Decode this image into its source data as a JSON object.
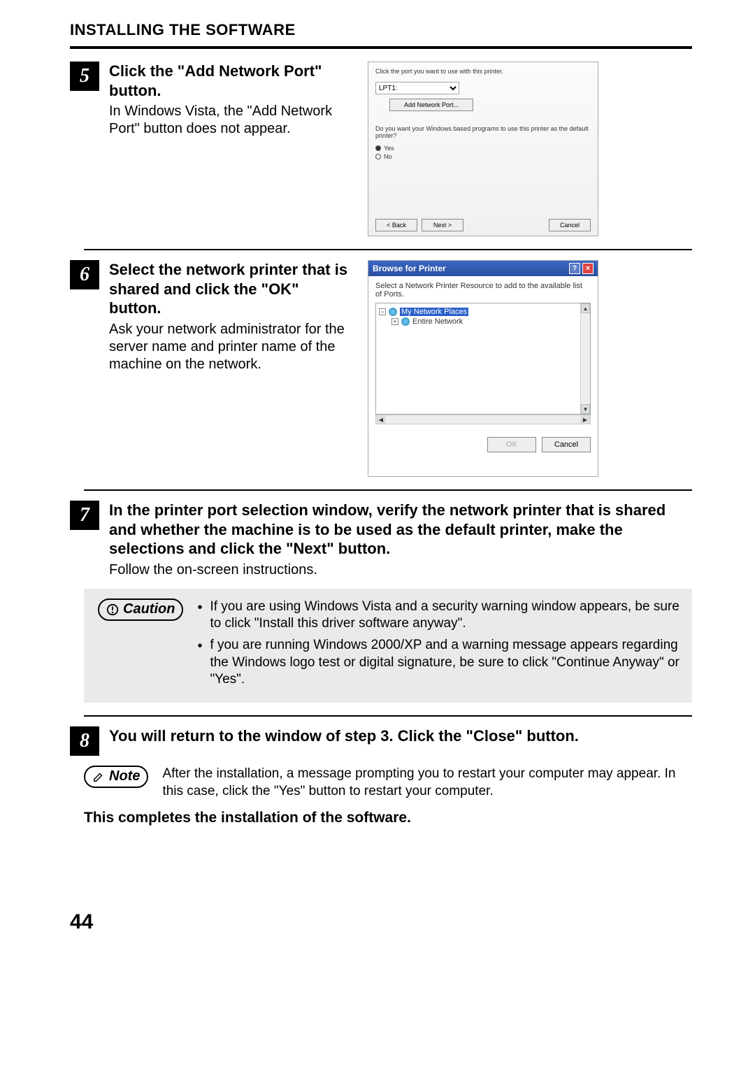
{
  "section_title": "INSTALLING THE SOFTWARE",
  "steps": {
    "s5": {
      "num": "5",
      "title": "Click the \"Add Network Port\" button.",
      "body": "In Windows Vista, the \"Add Network Port\" button does not appear."
    },
    "s6": {
      "num": "6",
      "title": "Select the network printer that is shared and click the \"OK\" button.",
      "body": "Ask your network administrator for the server name and printer name of the machine on the network."
    },
    "s7": {
      "num": "7",
      "title": "In the printer port selection window, verify the network printer that is shared and whether the machine is to be used as the default printer, make the selections and click the \"Next\" button.",
      "body": "Follow the on-screen instructions."
    },
    "s8": {
      "num": "8",
      "title": "You will return to the window of step 3. Click the \"Close\" button."
    }
  },
  "shot5": {
    "prompt": "Click the port you want to use with this printer.",
    "port_value": "LPT1:",
    "add_btn": "Add Network Port...",
    "question": "Do you want your Windows based programs to use this printer as the default printer?",
    "yes": "Yes",
    "no": "No",
    "back": "< Back",
    "next": "Next >",
    "cancel": "Cancel"
  },
  "shot6": {
    "title": "Browse for Printer",
    "help_icon": "?",
    "close_icon": "×",
    "instruction": "Select a Network Printer Resource to add to the available list of Ports.",
    "node_root": "My Network Places",
    "node_child": "Entire Network",
    "ok": "OK",
    "cancel": "Cancel"
  },
  "caution": {
    "label": "Caution",
    "items": [
      "If you are using Windows Vista and a security warning window appears, be sure to click \"Install this driver software anyway\".",
      "f you are running Windows 2000/XP and a warning message appears regarding the Windows logo test or digital signature, be sure to click \"Continue Anyway\" or \"Yes\"."
    ]
  },
  "note": {
    "label": "Note",
    "text": "After the installation, a message prompting you to restart your computer may appear. In this case, click the \"Yes\" button to restart your computer."
  },
  "conclusion": "This completes the installation of the software.",
  "page_number": "44"
}
